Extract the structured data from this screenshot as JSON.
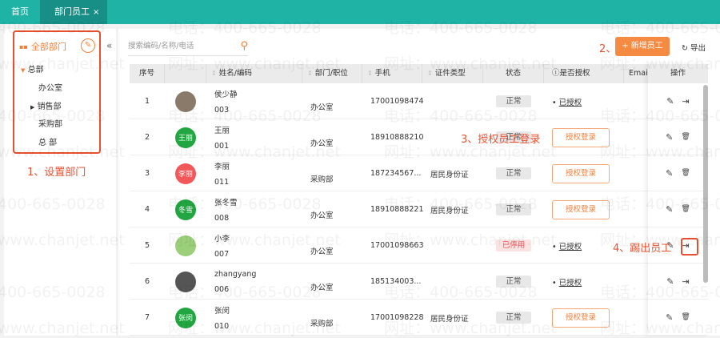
{
  "tabs": [
    {
      "label": "首页"
    },
    {
      "label": "部门员工",
      "close": "×"
    }
  ],
  "sidebar": {
    "title": "全部部门",
    "icon": "grid-icon",
    "tree": [
      "总部",
      "办公室",
      "销售部",
      "采购部",
      "总 部"
    ]
  },
  "search": {
    "placeholder": "搜索编码/名称/电话"
  },
  "toolbar": {
    "add_label": "+ 新增员工",
    "export_label": "导出"
  },
  "annotations": {
    "a1": "1、设置部门",
    "a2": "2、",
    "a3": "3、授权员工登录",
    "a4": "4、踢出员工"
  },
  "table": {
    "headers": [
      "序号",
      "",
      "姓名/编码",
      "部门/职位",
      "手机",
      "证件类型",
      "状态",
      "是否授权",
      "Emai",
      "操作"
    ],
    "rows": [
      {
        "no": "1",
        "avatar": "",
        "avatar_color": "#8a7a6a",
        "name": "侯少静",
        "code": "003",
        "dept": "办公室",
        "phone": "17001098474",
        "id_type": "",
        "status": "正常",
        "auth": "已授权",
        "op": "kick"
      },
      {
        "no": "2",
        "avatar": "王丽",
        "avatar_color": "#21a641",
        "name": "王丽",
        "code": "001",
        "dept": "办公室",
        "phone": "18910888210",
        "id_type": "",
        "status": "正常",
        "auth": "授权登录",
        "op": "delete"
      },
      {
        "no": "3",
        "avatar": "李丽",
        "avatar_color": "#f2575a",
        "name": "李丽",
        "code": "011",
        "dept": "采购部",
        "phone": "187234567...",
        "id_type": "居民身份证",
        "status": "正常",
        "auth": "授权登录",
        "op": "delete"
      },
      {
        "no": "4",
        "avatar": "冬雪",
        "avatar_color": "#21a641",
        "name": "张冬雪",
        "code": "008",
        "dept": "办公室",
        "phone": "18910888221",
        "id_type": "居民身份证",
        "status": "正常",
        "auth": "授权登录",
        "op": "delete"
      },
      {
        "no": "5",
        "avatar": "",
        "avatar_color": "#9ccf7a",
        "name": "小李",
        "code": "007",
        "dept": "办公室",
        "phone": "17001098663",
        "id_type": "",
        "status": "已停用",
        "auth": "已授权",
        "op": "kick"
      },
      {
        "no": "6",
        "avatar": "",
        "avatar_color": "#555555",
        "name": "zhangyang",
        "code": "006",
        "dept": "办公室",
        "phone": "185134003...",
        "id_type": "",
        "status": "正常",
        "auth": "已授权",
        "op": "kick"
      },
      {
        "no": "7",
        "avatar": "张闵",
        "avatar_color": "#21a641",
        "name": "张闵",
        "code": "010",
        "dept": "采购部",
        "phone": "17001098228",
        "id_type": "居民身份证",
        "status": "正常",
        "auth": "授权登录",
        "op": "delete"
      }
    ]
  },
  "watermark": {
    "phone": "电话：400-665-0028",
    "site": "网址：www.chanjet.net"
  },
  "colors": {
    "topbar": "#1fb3a6",
    "accent": "#f58a42",
    "annotation": "#e8502f"
  }
}
